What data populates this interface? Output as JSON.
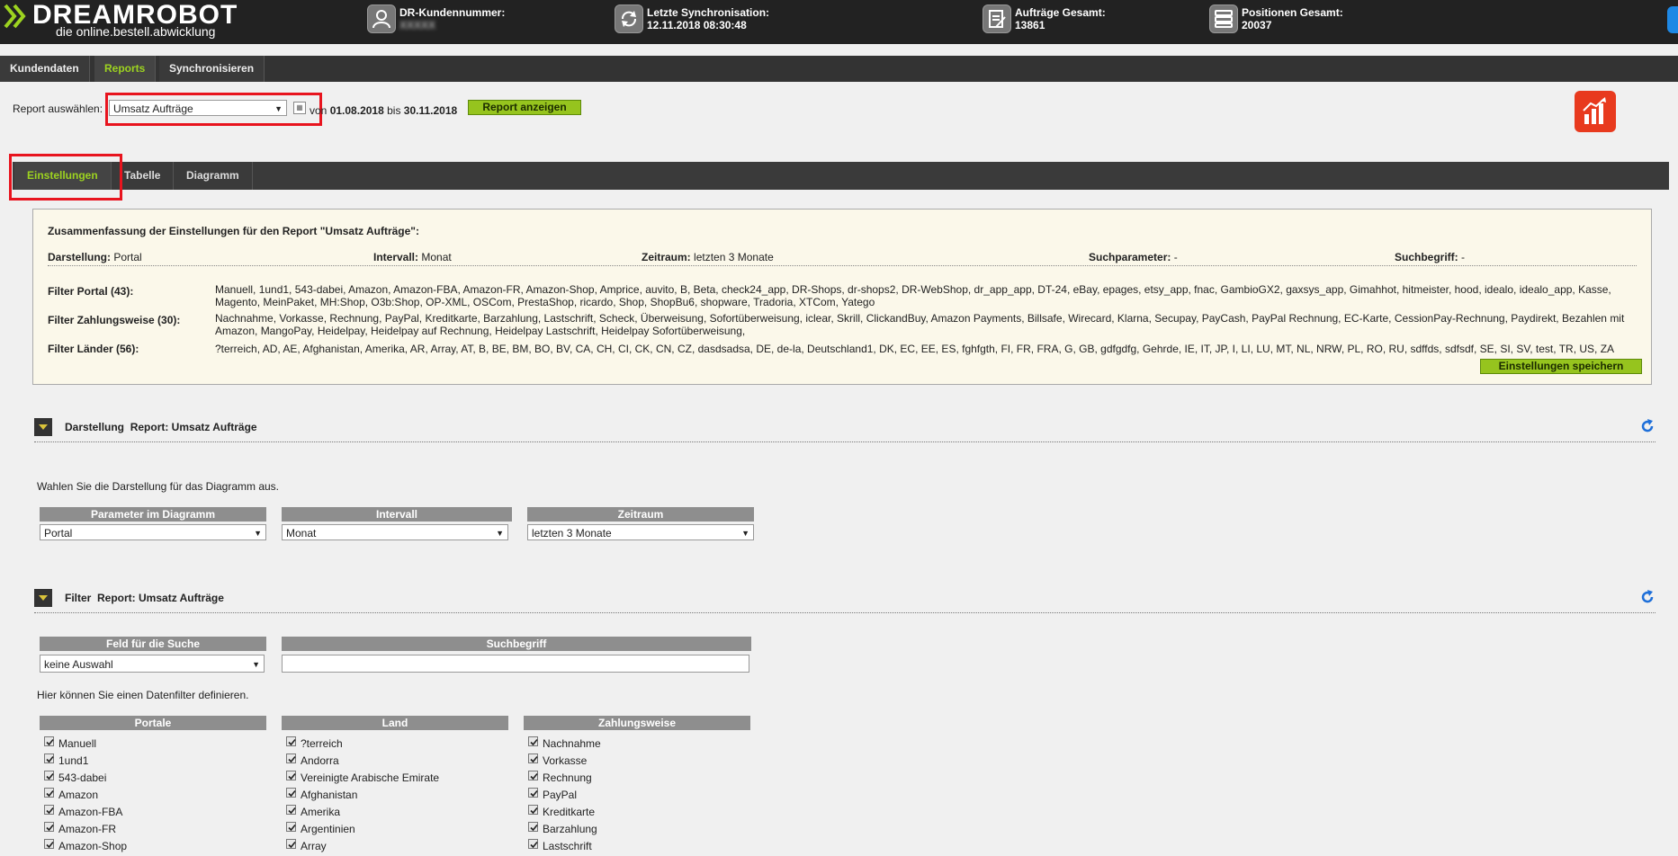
{
  "app": {
    "brand_part1": "DREAM",
    "brand_part2": "ROBOT",
    "tagline": "die online.bestell.abwicklung"
  },
  "stats": [
    {
      "label": "DR-Kundennummer:",
      "value": "",
      "icon": "user-icon"
    },
    {
      "label": "Letzte Synchronisation:",
      "value": "12.11.2018 08:30:48",
      "icon": "sync-icon"
    },
    {
      "label": "Aufträge Gesamt:",
      "value": "13861",
      "icon": "orders-icon"
    },
    {
      "label": "Positionen Gesamt:",
      "value": "20037",
      "icon": "list-icon"
    }
  ],
  "mainnav": [
    "Kundendaten",
    "Reports",
    "Synchronisieren"
  ],
  "report": {
    "label": "Report auswählen:",
    "selected": "Umsatz Aufträge",
    "von": "von",
    "from_date": "01.08.2018",
    "bis": "bis",
    "to_date": "30.11.2018",
    "button": "Report anzeigen"
  },
  "tabs": [
    "Einstellungen",
    "Tabelle",
    "Diagramm"
  ],
  "summary": {
    "title": "Zusammenfassung der Einstellungen für den Report \"Umsatz Aufträge\":",
    "darstellung_label": "Darstellung:",
    "darstellung_value": "Portal",
    "intervall_label": "Intervall:",
    "intervall_value": "Monat",
    "zeitraum_label": "Zeitraum:",
    "zeitraum_value": "letzten 3 Monate",
    "suchparameter_label": "Suchparameter:",
    "suchparameter_value": "-",
    "suchbegriff_label": "Suchbegriff:",
    "suchbegriff_value": "-",
    "filter_portal_label": "Filter Portal (43):",
    "filter_portal_value": "Manuell, 1und1, 543-dabei, Amazon, Amazon-FBA, Amazon-FR, Amazon-Shop, Amprice, auvito, B, Beta, check24_app, DR-Shops, dr-shops2, DR-WebShop, dr_app_app, DT-24, eBay, epages, etsy_app, fnac, GambioGX2, gaxsys_app, Gimahhot, hitmeister, hood, idealo, idealo_app, Kasse, Magento, MeinPaket, MH:Shop, O3b:Shop, OP-XML, OSCom, PrestaShop, ricardo, Shop, ShopBu6, shopware, Tradoria, XTCom, Yatego",
    "filter_zahlung_label": "Filter Zahlungsweise (30):",
    "filter_zahlung_value": "Nachnahme, Vorkasse, Rechnung, PayPal, Kreditkarte, Barzahlung, Lastschrift, Scheck, Überweisung, Sofortüberweisung, iclear, Skrill, ClickandBuy, Amazon Payments, Billsafe, Wirecard, Klarna, Secupay, PayCash, PayPal Rechnung, EC-Karte, CessionPay-Rechnung, Paydirekt, Bezahlen mit Amazon, MangoPay, Heidelpay, Heidelpay auf Rechnung, Heidelpay Lastschrift, Heidelpay Sofortüberweisung,",
    "filter_laender_label": "Filter Länder (56):",
    "filter_laender_value": "?terreich, AD, AE, Afghanistan, Amerika, AR, Array, AT, B, BE, BM, BO, BV, CA, CH, CI, CK, CN, CZ, dasdsadsa, DE, de-la, Deutschland1, DK, EC, EE, ES, fghfgth, FI, FR, FRA, G, GB, gdfgdfg, Gehrde, IE, IT, JP, I, LI, LU, MT, NL, NRW, PL, RO, RU, sdffds, sdfsdf, SE, SI, SV, test, TR, US, ZA",
    "save_button": "Einstellungen speichern"
  },
  "darstellung": {
    "heading_a": "Darstellung",
    "heading_b": "Report: Umsatz Aufträge",
    "hint": "Wahlen Sie die Darstellung für das Diagramm aus.",
    "col1_head": "Parameter im Diagramm",
    "col1_value": "Portal",
    "col2_head": "Intervall",
    "col2_value": "Monat",
    "col3_head": "Zeitraum",
    "col3_value": "letzten 3 Monate"
  },
  "filter": {
    "heading_a": "Filter",
    "heading_b": "Report: Umsatz Aufträge",
    "feld_head": "Feld für die Suche",
    "feld_value": "keine Auswahl",
    "such_head": "Suchbegriff",
    "such_value": "",
    "hint": "Hier können Sie einen Datenfilter definieren.",
    "portale_head": "Portale",
    "land_head": "Land",
    "zahlung_head": "Zahlungsweise",
    "portale": [
      "Manuell",
      "1und1",
      "543-dabei",
      "Amazon",
      "Amazon-FBA",
      "Amazon-FR",
      "Amazon-Shop"
    ],
    "land": [
      "?terreich",
      "Andorra",
      "Vereinigte Arabische Emirate",
      "Afghanistan",
      "Amerika",
      "Argentinien",
      "Array"
    ],
    "zahlung": [
      "Nachnahme",
      "Vorkasse",
      "Rechnung",
      "PayPal",
      "Kreditkarte",
      "Barzahlung",
      "Lastschrift"
    ]
  },
  "colors": {
    "accent_green": "#96c41e",
    "highlight_red": "#e8141e",
    "chart_icon_bg": "#e83a1e",
    "refresh_blue": "#1e6fd9"
  }
}
